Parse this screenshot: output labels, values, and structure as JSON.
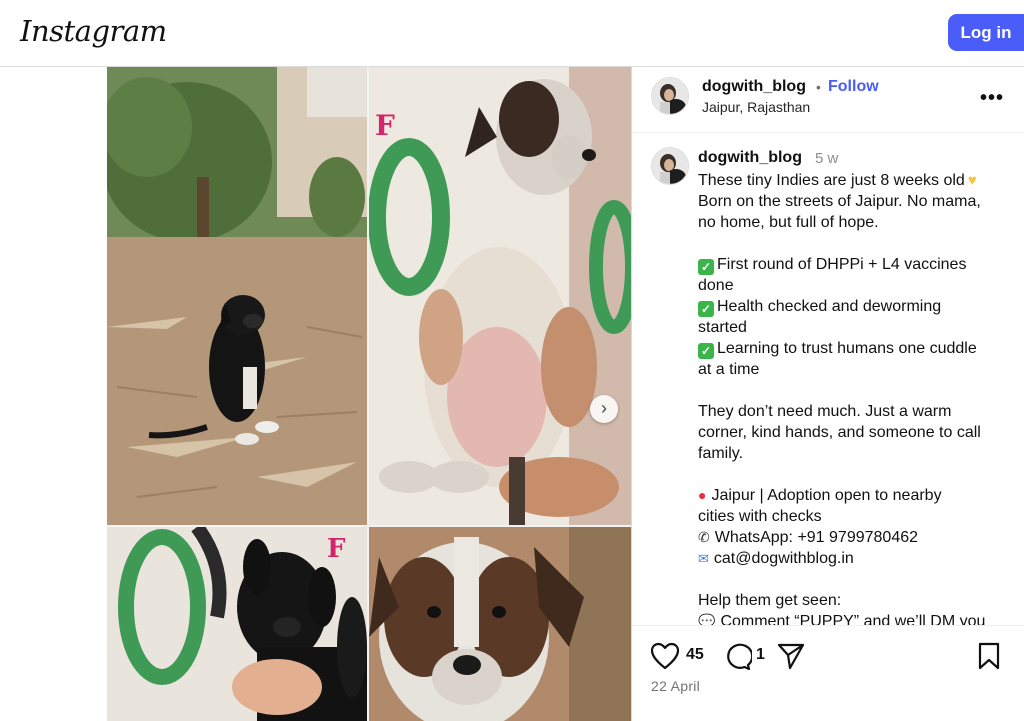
{
  "app": {
    "logo_text": "Instagram",
    "login_label": "Log in",
    "accent_color": "#4a5df9"
  },
  "post": {
    "username": "dogwith_blog",
    "separator": "•",
    "follow_label": "Follow",
    "location": "Jaipur, Rajasthan",
    "more_icon": "more-horizontal-icon",
    "media": {
      "tile_letters": [
        "F",
        "F"
      ],
      "next_icon": "chevron-right-icon"
    },
    "caption": {
      "username": "dogwith_blog",
      "age": "5 w",
      "line1": "These tiny Indies are just 8 weeks old",
      "line2": "Born on the streets of Jaipur. No mama,",
      "line3": "no home, but full of hope.",
      "line4": "First round of DHPPi + L4 vaccines",
      "line5": "done",
      "line6": "Health checked and deworming",
      "line7": "started",
      "line8": "Learning to trust humans one cuddle",
      "line9": "at a time",
      "line10": "They don’t need much. Just a warm",
      "line11": "corner, kind hands, and someone to call",
      "line12": "family.",
      "line13": "Jaipur | Adoption open to nearby",
      "line14": "cities with checks",
      "line15": "WhatsApp: +91 9799780462",
      "line16": "cat@dogwithblog.in",
      "line17": "Help them get seen:",
      "line18": "Comment “PUPPY” and we’ll DM you"
    },
    "actions": {
      "likes": "45",
      "comments": "1",
      "date": "22 April"
    }
  }
}
